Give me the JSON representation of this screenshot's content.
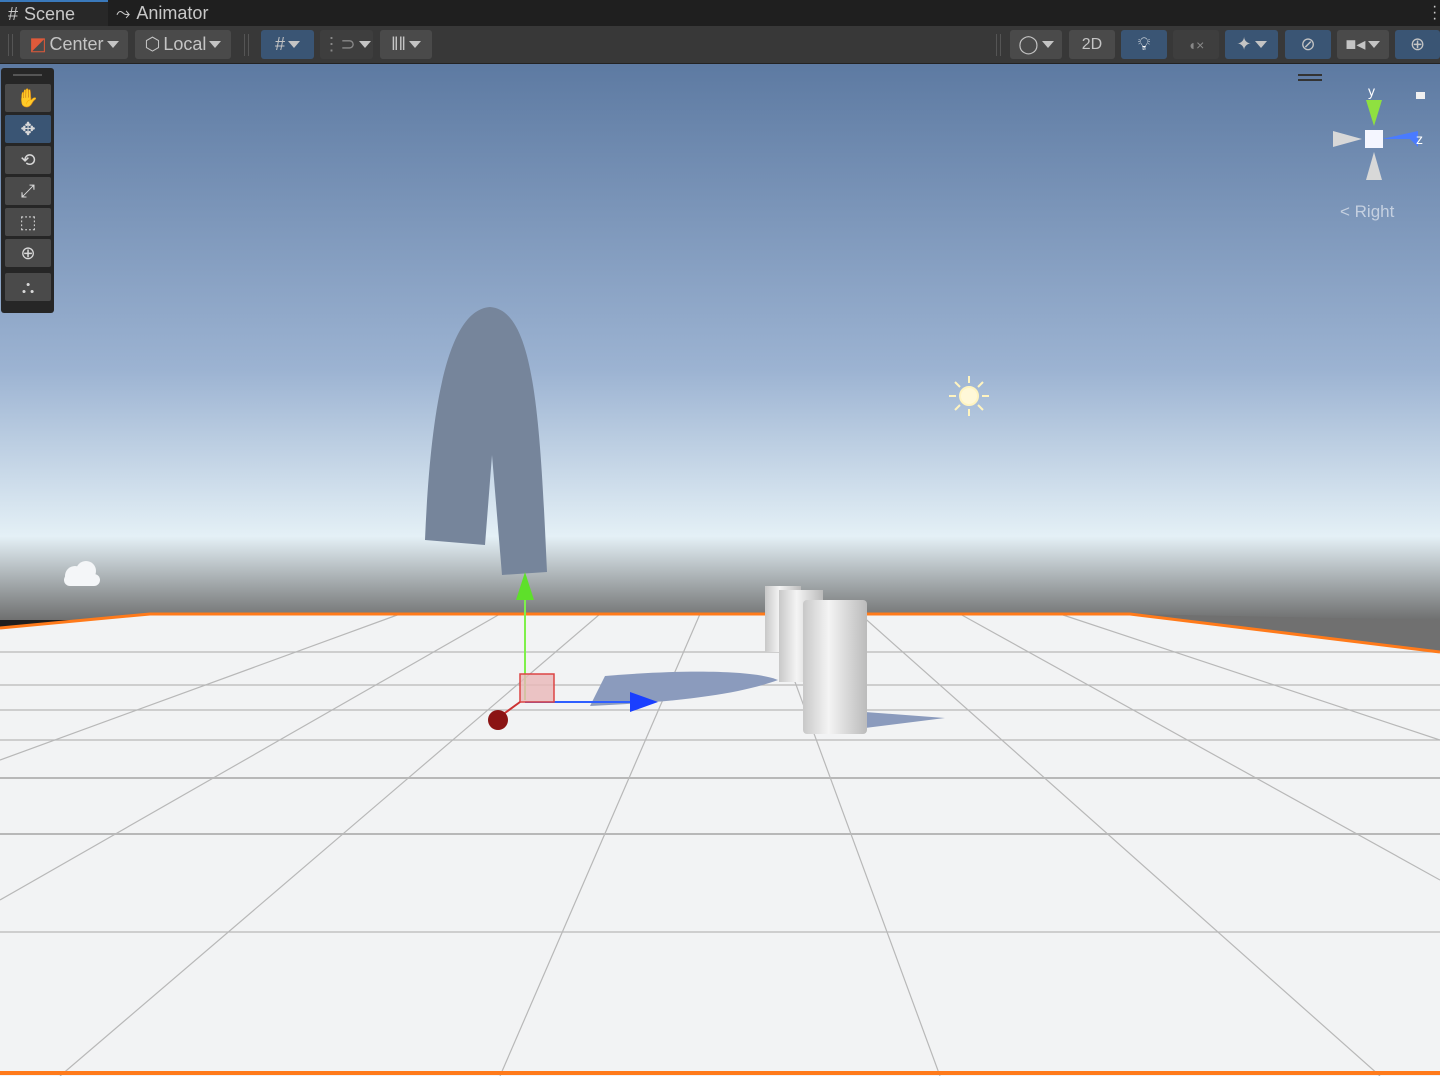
{
  "tabs": [
    {
      "label": "Scene",
      "icon": "grid-hash-icon",
      "active": true
    },
    {
      "label": "Animator",
      "icon": "animator-icon",
      "active": false
    }
  ],
  "toolbar": {
    "pivot_label": "Center",
    "space_label": "Local",
    "mode_2d_label": "2D"
  },
  "tools": [
    {
      "name": "hand-tool",
      "glyph": "✋"
    },
    {
      "name": "move-tool",
      "glyph": "✥"
    },
    {
      "name": "rotate-tool",
      "glyph": "⟲"
    },
    {
      "name": "scale-tool",
      "glyph": "⤢"
    },
    {
      "name": "rect-tool",
      "glyph": "⬚"
    },
    {
      "name": "transform-tool",
      "glyph": "⊕"
    },
    {
      "name": "custom-tool",
      "glyph": "⛬"
    }
  ],
  "gizmo": {
    "y_label": "y",
    "z_label": "z",
    "view_label": "Right"
  },
  "colors": {
    "accent": "#3a5574",
    "selection_outline": "#ff7a1a"
  }
}
